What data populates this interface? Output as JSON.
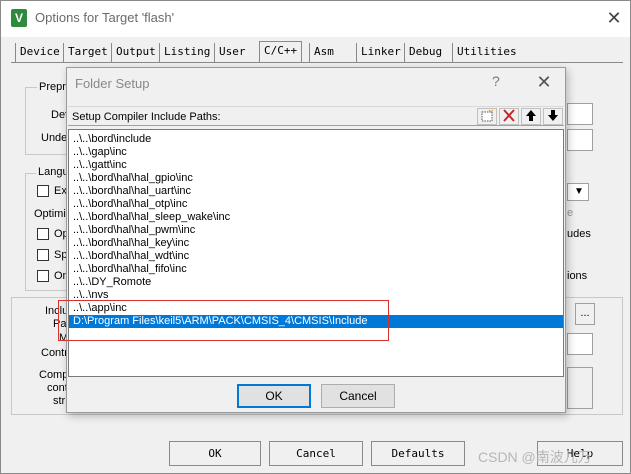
{
  "outer": {
    "title": "Options for Target 'flash'",
    "icon_letter": "V",
    "close_glyph": "✕",
    "tabs": [
      "Device",
      "Target",
      "Output",
      "Listing",
      "User",
      "C/C++",
      "Asm",
      "Linker",
      "Debug",
      "Utilities"
    ],
    "active_tab": "C/C++",
    "bg_fragments": {
      "preprocessor_group": "Prepro",
      "define_label": "Def",
      "undefine_label": "Undef",
      "language_group": "Langu",
      "ex_label": "Ex",
      "optimize_label": "Optimiz",
      "op_label": "Op",
      "sp_label": "Sp",
      "on_label": "On",
      "include_label": "Inclu",
      "paths_label": "Pat",
      "misc_label": "M",
      "controls_label": "Contr",
      "compiler_label": "Comp",
      "control_label": "cont",
      "string_label": "stri",
      "right_e": "e",
      "right_udes": "udes",
      "right_ions": "ions",
      "browse_button": "..."
    },
    "buttons": {
      "ok": "OK",
      "cancel": "Cancel",
      "defaults": "Defaults",
      "help": "Help"
    }
  },
  "folder_setup": {
    "title": "Folder Setup",
    "help_glyph": "?",
    "close_glyph": "✕",
    "header_label": "Setup Compiler Include Paths:",
    "toolbar_icons": [
      "new-folder-icon",
      "delete-icon",
      "move-up-icon",
      "move-down-icon"
    ],
    "paths": [
      "..\\..\\bord\\include",
      "..\\..\\gap\\inc",
      "..\\..\\gatt\\inc",
      "..\\..\\bord\\hal\\hal_gpio\\inc",
      "..\\..\\bord\\hal\\hal_uart\\inc",
      "..\\..\\bord\\hal\\hal_otp\\inc",
      "..\\..\\bord\\hal\\hal_sleep_wake\\inc",
      "..\\..\\bord\\hal\\hal_pwm\\inc",
      "..\\..\\bord\\hal\\hal_key\\inc",
      "..\\..\\bord\\hal\\hal_wdt\\inc",
      "..\\..\\bord\\hal\\hal_fifo\\inc",
      "..\\..\\DY_Romote",
      "..\\..\\nvs",
      "..\\..\\app\\inc",
      "D:\\Program Files\\keil5\\ARM\\PACK\\CMSIS_4\\CMSIS\\Include"
    ],
    "selected_index": 14,
    "buttons": {
      "ok": "OK",
      "cancel": "Cancel"
    }
  },
  "watermark": "CSDN @南波儿万",
  "colors": {
    "selection": "#0078d7",
    "highlight_box": "#d9302c",
    "icon_green": "#2e8b3e"
  }
}
